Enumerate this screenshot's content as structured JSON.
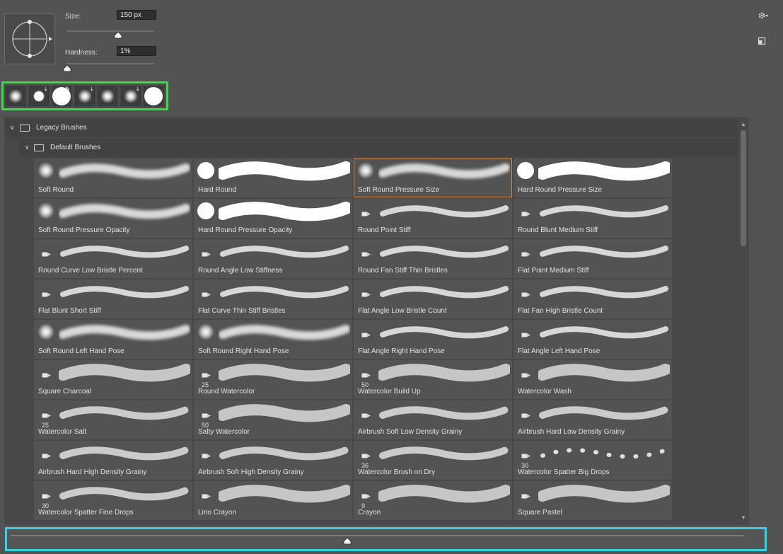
{
  "brush_settings": {
    "size_label": "Size:",
    "size_value": "150 px",
    "size_fraction": 0.59,
    "hardness_label": "Hardness:",
    "hardness_value": "1%",
    "hardness_fraction": 0.01
  },
  "icons": {
    "settings": "gear-icon",
    "new_brush": "new-brush-icon"
  },
  "recent_brushes": [
    {
      "dab": "soft",
      "marker": ""
    },
    {
      "dab": "hard-small",
      "marker": "import"
    },
    {
      "dab": "hard-large",
      "marker": "edit"
    },
    {
      "dab": "soft",
      "marker": "import"
    },
    {
      "dab": "soft",
      "marker": ""
    },
    {
      "dab": "soft",
      "marker": "import"
    },
    {
      "dab": "hard-large",
      "marker": ""
    }
  ],
  "groups": {
    "legacy": "Legacy Brushes",
    "default": "Default Brushes"
  },
  "brushes": [
    {
      "name": "Soft Round",
      "num": "",
      "kind": "soft"
    },
    {
      "name": "Hard Round",
      "num": "",
      "kind": "hard"
    },
    {
      "name": "Soft Round Pressure Size",
      "num": "",
      "kind": "soft",
      "selected": true
    },
    {
      "name": "Hard Round Pressure Size",
      "num": "",
      "kind": "hard"
    },
    {
      "name": "Soft Round Pressure Opacity",
      "num": "",
      "kind": "soft"
    },
    {
      "name": "Hard Round Pressure Opacity",
      "num": "",
      "kind": "hard"
    },
    {
      "name": "Round Point Stiff",
      "num": "",
      "kind": "bristle"
    },
    {
      "name": "Round Blunt Medium Stiff",
      "num": "",
      "kind": "bristle"
    },
    {
      "name": "Round Curve Low Bristle Percent",
      "num": "",
      "kind": "bristle"
    },
    {
      "name": "Round Angle Low Stiffness",
      "num": "",
      "kind": "bristle"
    },
    {
      "name": "Round Fan Stiff Thin Bristles",
      "num": "",
      "kind": "bristle"
    },
    {
      "name": "Flat Point Medium Stiff",
      "num": "",
      "kind": "bristle"
    },
    {
      "name": "Flat Blunt Short Stiff",
      "num": "",
      "kind": "bristle"
    },
    {
      "name": "Flat Curve Thin Stiff Bristles",
      "num": "",
      "kind": "bristle"
    },
    {
      "name": "Flat Angle Low Bristle Count",
      "num": "",
      "kind": "bristle"
    },
    {
      "name": "Flat Fan High Bristle Count",
      "num": "",
      "kind": "bristle"
    },
    {
      "name": "Soft Round Left Hand Pose",
      "num": "",
      "kind": "soft"
    },
    {
      "name": "Soft Round Right Hand Pose",
      "num": "",
      "kind": "soft"
    },
    {
      "name": "Flat Angle Right Hand Pose",
      "num": "",
      "kind": "bristle"
    },
    {
      "name": "Flat Angle Left Hand Pose",
      "num": "",
      "kind": "bristle"
    },
    {
      "name": "Square Charcoal",
      "num": "",
      "kind": "textured"
    },
    {
      "name": "Round Watercolor",
      "num": "25",
      "kind": "textured"
    },
    {
      "name": "Watercolor Build Up",
      "num": "50",
      "kind": "textured"
    },
    {
      "name": "Watercolor Wash",
      "num": "",
      "kind": "textured"
    },
    {
      "name": "Watercolor Salt",
      "num": "25",
      "kind": "speckle"
    },
    {
      "name": "Salty Watercolor",
      "num": "50",
      "kind": "textured"
    },
    {
      "name": "Airbrush Soft Low Density Grainy",
      "num": "",
      "kind": "speckle"
    },
    {
      "name": "Airbrush Hard Low Density Grainy",
      "num": "",
      "kind": "speckle"
    },
    {
      "name": "Airbrush Hard High Density Grainy",
      "num": "",
      "kind": "speckle"
    },
    {
      "name": "Airbrush Soft High Density Grainy",
      "num": "",
      "kind": "speckle"
    },
    {
      "name": "Watercolor Brush on Dry",
      "num": "36",
      "kind": "speckle"
    },
    {
      "name": "Watercolor Spatter Big Drops",
      "num": "30",
      "kind": "drops"
    },
    {
      "name": "Watercolor Spatter Fine Drops",
      "num": "30",
      "kind": "speckle"
    },
    {
      "name": "Lino Crayon",
      "num": "",
      "kind": "textured"
    },
    {
      "name": "Crayon",
      "num": "9",
      "kind": "textured"
    },
    {
      "name": "Square Pastel",
      "num": "",
      "kind": "textured"
    }
  ],
  "thumbnail_size_fraction": 0.46
}
